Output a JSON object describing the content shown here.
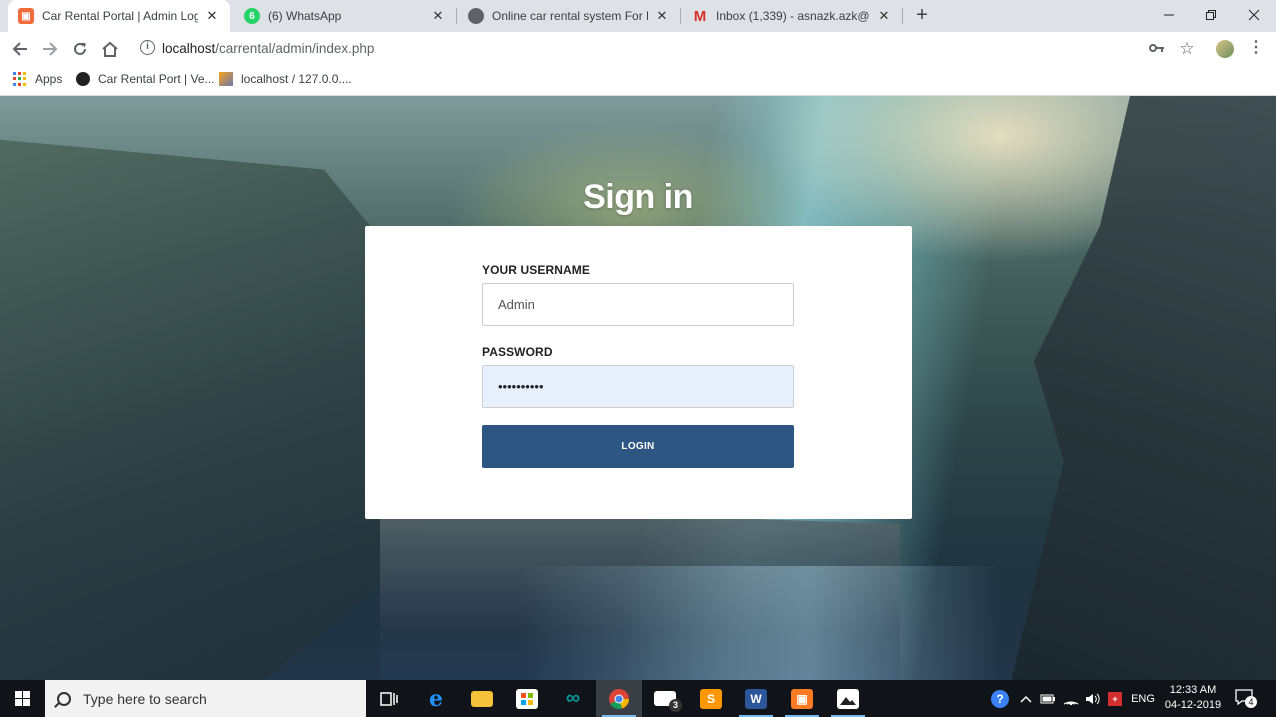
{
  "browser": {
    "tabs": [
      {
        "title": "Car Rental Portal | Admin Login",
        "favicon_color": "#f26b3a",
        "favicon_icon": "xampp-icon",
        "active": true
      },
      {
        "title": "(6) WhatsApp",
        "favicon_color": "#25d366",
        "favicon_icon": "whatsapp-icon",
        "active": false
      },
      {
        "title": "Online car rental system For Fina",
        "favicon_color": "#5f6368",
        "favicon_icon": "globe-icon",
        "active": false
      },
      {
        "title": "Inbox (1,339) - asnazk.azk@gma",
        "favicon_color": "#d93025",
        "favicon_icon": "gmail-icon",
        "active": false
      }
    ],
    "whatsapp_badge": "6",
    "url_host": "localhost",
    "url_path": "/carrental/admin/index.php",
    "bookmarks": [
      {
        "label": "Apps",
        "icon": "apps-grid-icon"
      },
      {
        "label": "Car Rental Port | Ve...",
        "icon": "car-rental-icon"
      },
      {
        "label": "localhost / 127.0.0....",
        "icon": "phpmyadmin-icon"
      }
    ]
  },
  "page": {
    "title": "Sign in",
    "username_label": "YOUR USERNAME",
    "username_value": "Admin",
    "password_label": "PASSWORD",
    "password_value": "••••••••••",
    "login_label": "LOGIN",
    "login_color": "#2e5683"
  },
  "taskbar": {
    "search_placeholder": "Type here to search",
    "mail_badge": "3",
    "language": "ENG",
    "time": "12:33 AM",
    "date": "04-12-2019",
    "notification_count": "4"
  }
}
